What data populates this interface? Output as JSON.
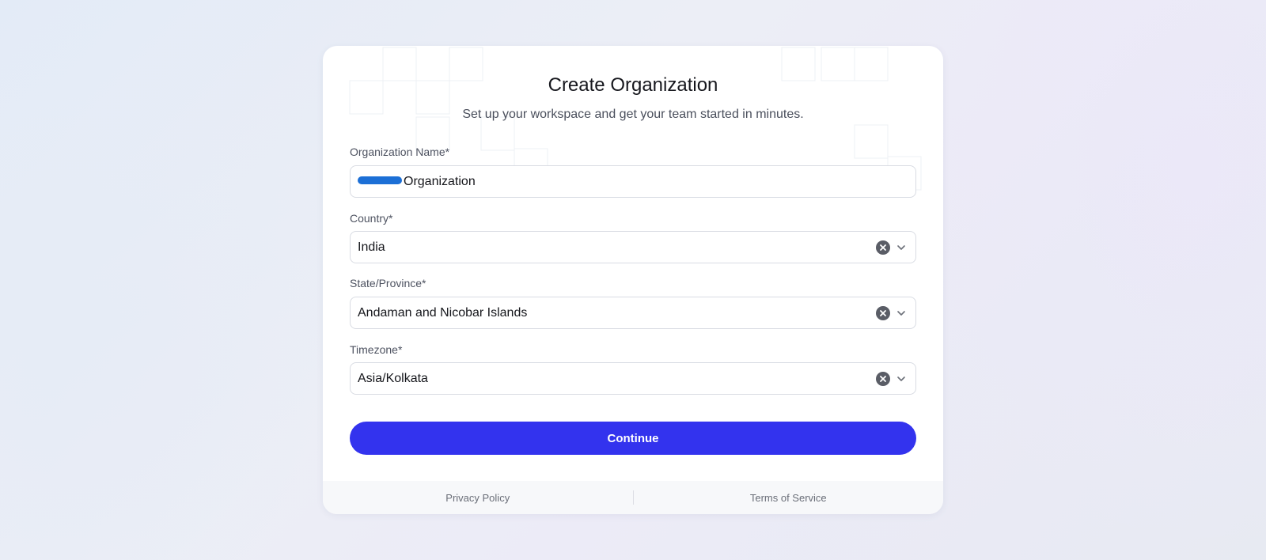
{
  "header": {
    "title": "Create Organization",
    "subtitle": "Set up your workspace and get your team started in minutes."
  },
  "form": {
    "organization_name": {
      "label": "Organization Name*",
      "value": "Organization",
      "redacted_prefix": true
    },
    "country": {
      "label": "Country*",
      "value": "India"
    },
    "state": {
      "label": "State/Province*",
      "value": "Andaman and Nicobar Islands"
    },
    "timezone": {
      "label": "Timezone*",
      "value": "Asia/Kolkata"
    }
  },
  "actions": {
    "continue_label": "Continue"
  },
  "footer": {
    "privacy": "Privacy Policy",
    "terms": "Terms of Service"
  },
  "colors": {
    "accent": "#3333ee",
    "redaction": "#1c6fd6",
    "clear_icon": "#5a5d66"
  },
  "icons": {
    "clear": "clear-icon",
    "dropdown": "chevron-down-icon"
  }
}
